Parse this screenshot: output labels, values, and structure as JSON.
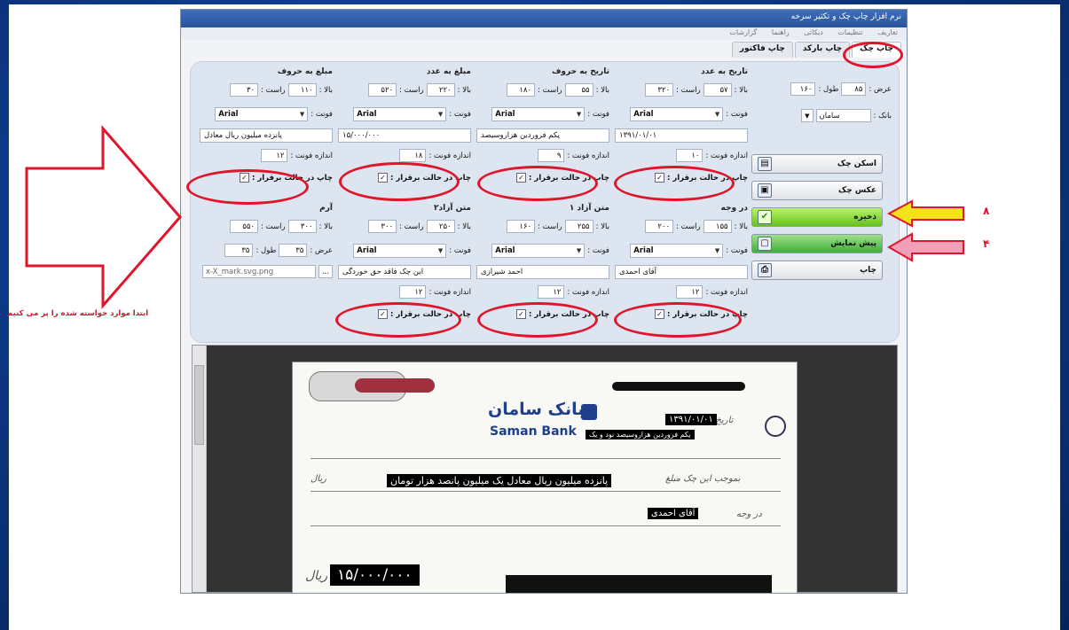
{
  "window": {
    "title": "نرم افزار چاپ چک و تکثیر سرخه",
    "menu": [
      "تعاریف",
      "تنظیمات",
      "دیکاتی",
      "راهنما",
      "گزارشات"
    ],
    "tabs": [
      "چاپ چک",
      "چاپ بارکد",
      "چاپ فاکتور"
    ]
  },
  "cheque_settings": {
    "width_label": "عرض :",
    "width_value": "۸۵",
    "length_label": "طول :",
    "length_value": "۱۶۰",
    "bank_label": "بانک :",
    "bank_value": "سامان"
  },
  "groups": {
    "date_num": {
      "title": "تاریخ به عدد",
      "top_label": "بالا :",
      "top_value": "۵۷",
      "right_label": "راست :",
      "right_value": "۳۲۰",
      "font_label": "فونت :",
      "font_value": "Arial",
      "text_value": "۱۳۹۱/۰۱/۰۱",
      "size_label": "اندازه فونت :",
      "size_value": "۱۰",
      "print_label": "چاپ در حالت برقرار :"
    },
    "date_words": {
      "title": "تاریخ به حروف",
      "top_label": "بالا :",
      "top_value": "۵۵",
      "right_label": "راست :",
      "right_value": "۱۸۰",
      "font_label": "فونت :",
      "font_value": "Arial",
      "text_value": "یکم فروردین هزاروسیصد",
      "size_label": "اندازه فونت :",
      "size_value": "۹",
      "print_label": "چاپ در حالت برقرار :"
    },
    "amount_num": {
      "title": "مبلغ به عدد",
      "top_label": "بالا :",
      "top_value": "۲۲۰",
      "right_label": "راست :",
      "right_value": "۵۲۰",
      "font_label": "فونت :",
      "font_value": "Arial",
      "text_value": "۱۵/۰۰۰/۰۰۰",
      "size_label": "اندازه فونت :",
      "size_value": "۱۸",
      "print_label": "چاپ در حالت برقرار :"
    },
    "amount_words": {
      "title": "مبلغ به حروف",
      "top_label": "بالا :",
      "top_value": "۱۱۰",
      "right_label": "راست :",
      "right_value": "۳۰",
      "font_label": "فونت :",
      "font_value": "Arial",
      "text_value": "پانزده میلیون ریال معادل",
      "size_label": "اندازه فونت :",
      "size_value": "۱۲",
      "print_label": "چاپ در حالت برقرار :"
    },
    "payee": {
      "title": "در وجه",
      "top_label": "بالا :",
      "top_value": "۱۵۵",
      "right_label": "راست :",
      "right_value": "۲۰۰",
      "font_label": "فونت :",
      "font_value": "Arial",
      "text_value": "آقای احمدی",
      "size_label": "اندازه فونت :",
      "size_value": "۱۲",
      "print_label": "چاپ در حالت برقرار :"
    },
    "free1": {
      "title": "متن آزاد ۱",
      "top_label": "بالا :",
      "top_value": "۲۵۵",
      "right_label": "راست :",
      "right_value": "۱۶۰",
      "font_label": "فونت :",
      "font_value": "Arial",
      "text_value": "احمد شیرازی",
      "size_label": "اندازه فونت :",
      "size_value": "۱۲",
      "print_label": "چاپ در حالت برقرار :"
    },
    "free2": {
      "title": "متن آزاد۲",
      "top_label": "بالا :",
      "top_value": "۲۵۰",
      "right_label": "راست :",
      "right_value": "۳۰۰",
      "font_label": "فونت :",
      "font_value": "Arial",
      "text_value": "این چک فاقد حق خوردگی",
      "size_label": "اندازه فونت :",
      "size_value": "۱۲",
      "print_label": "چاپ در حالت برقرار :"
    },
    "logo": {
      "title": "آرم",
      "top_label": "بالا :",
      "top_value": "۳۰۰",
      "right_label": "راست :",
      "right_value": "۵۵۰",
      "width_label": "عرض :",
      "width_value": "۳۵",
      "length_label": "طول :",
      "length_value": "۳۵",
      "file_value": "x-X_mark.svg.png",
      "browse_label": "..."
    }
  },
  "side_buttons": {
    "scan": "اسکن چک",
    "photo": "عکس چک",
    "save": "ذخیره",
    "preview": "پیش نمایش",
    "print": "چاپ"
  },
  "annotations": {
    "note": "ابتدا موارد خواسته شده را پر می کنیم",
    "arrow1_number": "۸",
    "arrow2_number": "۴"
  },
  "preview": {
    "bank_name_fa": "بانک سامان",
    "bank_name_en": "Saman Bank",
    "date_caption": "تاریخ :",
    "date_value": "۱۳۹۱/۰۱/۰۱",
    "date_words": "یکم فروردین هزاروسیصد نود و یک",
    "amount_words": "پانزده میلیون ریال معادل یک میلیون پانصد هزار تومان",
    "payee": "آقای احمدی",
    "amount_number": "۱۵/۰۰۰/۰۰۰",
    "pay_caption": "بموجب این چک مبلغ",
    "rial1": "ریال",
    "payee_caption": "در وجه",
    "rial2": "ریال"
  },
  "colors": {
    "annotation_red": "#e0142a",
    "save_button": "#8ee03c",
    "preview_button": "#4fbf3f",
    "yellow_arrow": "#f7e21a",
    "pink_arrow": "#f2a0b8"
  }
}
